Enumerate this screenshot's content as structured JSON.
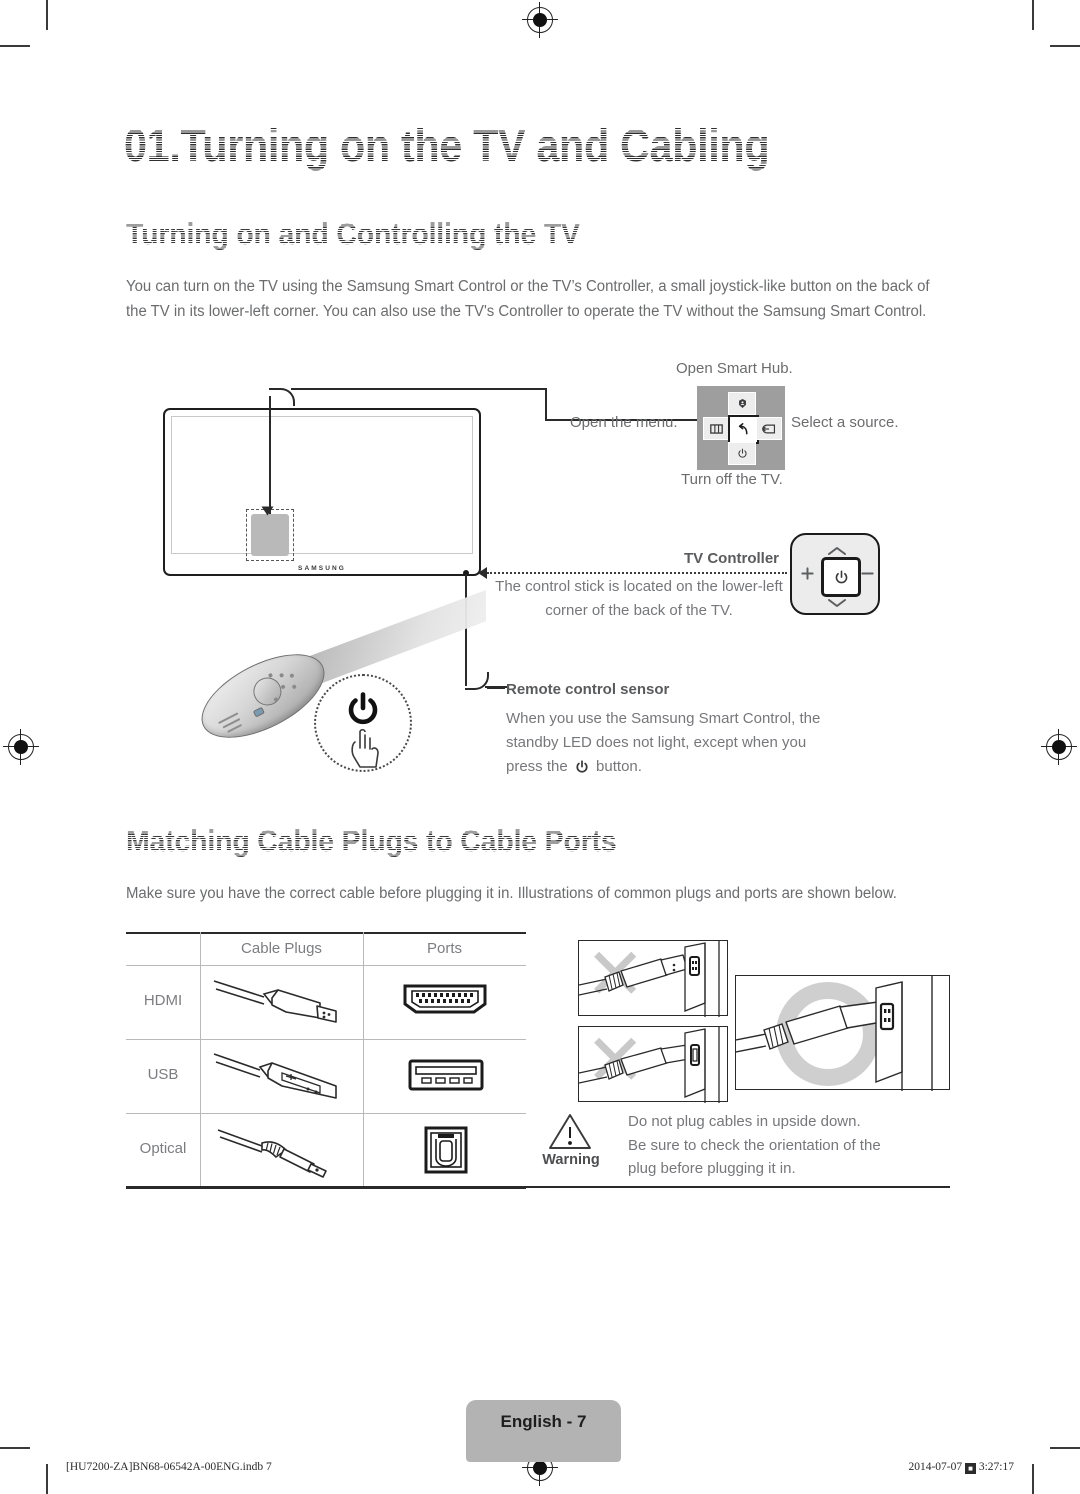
{
  "document": {
    "chapter_title": "01.Turning on the TV and Cabling",
    "sections": [
      {
        "heading": "Turning on and Controlling the TV",
        "intro": "You can turn on the TV using the Samsung Smart Control or the TV’s Controller, a small joystick-like button on the back of the TV in its lower-left corner. You can also use the TV's Controller to operate the TV without the Samsung Smart Control."
      },
      {
        "heading": "Matching Cable Plugs to Cable Ports",
        "intro": "Make sure you have the correct cable before plugging it in. Illustrations of common plugs and ports are shown below."
      }
    ]
  },
  "diagram": {
    "tv_brand": "SAMSUNG",
    "controller_callouts": {
      "top": "Open Smart Hub.",
      "left": "Open the menu.",
      "right": "Select a source.",
      "bottom": "Turn off the TV."
    },
    "tv_controller": {
      "label": "TV Controller",
      "description": "The control stick is located on the lower-left corner of the back of the TV."
    },
    "remote_sensor": {
      "label": "Remote control sensor",
      "description_line1": "When you use the Samsung Smart Control, the",
      "description_line2": "standby LED does not light, except when you",
      "description_line3_prefix": "press the",
      "description_line3_suffix": "button."
    }
  },
  "cable_table": {
    "columns": [
      "",
      "Cable Plugs",
      "Ports"
    ],
    "rows": [
      {
        "label": "HDMI",
        "plug_icon": "hdmi-plug-icon",
        "port_icon": "hdmi-port-icon"
      },
      {
        "label": "USB",
        "plug_icon": "usb-plug-icon",
        "port_icon": "usb-port-icon"
      },
      {
        "label": "Optical",
        "plug_icon": "optical-plug-icon",
        "port_icon": "optical-port-icon"
      }
    ]
  },
  "orientation": {
    "wrong_mark": "✕",
    "correct_mark": "O",
    "panels": [
      {
        "name": "wrong-upside-down-hdmi",
        "state": "wrong"
      },
      {
        "name": "wrong-upside-down-usb",
        "state": "wrong"
      },
      {
        "name": "correct-orientation",
        "state": "correct"
      }
    ]
  },
  "warning": {
    "label": "Warning",
    "icon": "warning-triangle-icon",
    "line1": "Do not plug cables in upside down.",
    "line2": "Be sure to check the orientation of the",
    "line3": "plug before plugging it in."
  },
  "footer": {
    "page_label": "English - 7",
    "file_reference": "[HU7200-ZA]BN68-06542A-00ENG.indb   7",
    "date": "2014-07-07",
    "time": "3:27:17",
    "separator_glyph": "■"
  },
  "colors": {
    "text_body": "#6b6c6e",
    "heading": "#2f2f2f",
    "rule": "#2a2a2a",
    "page_pill": "#b3b3b3",
    "controller_bg": "#9e9e9e",
    "mark_gray": "#cfcfcf"
  }
}
